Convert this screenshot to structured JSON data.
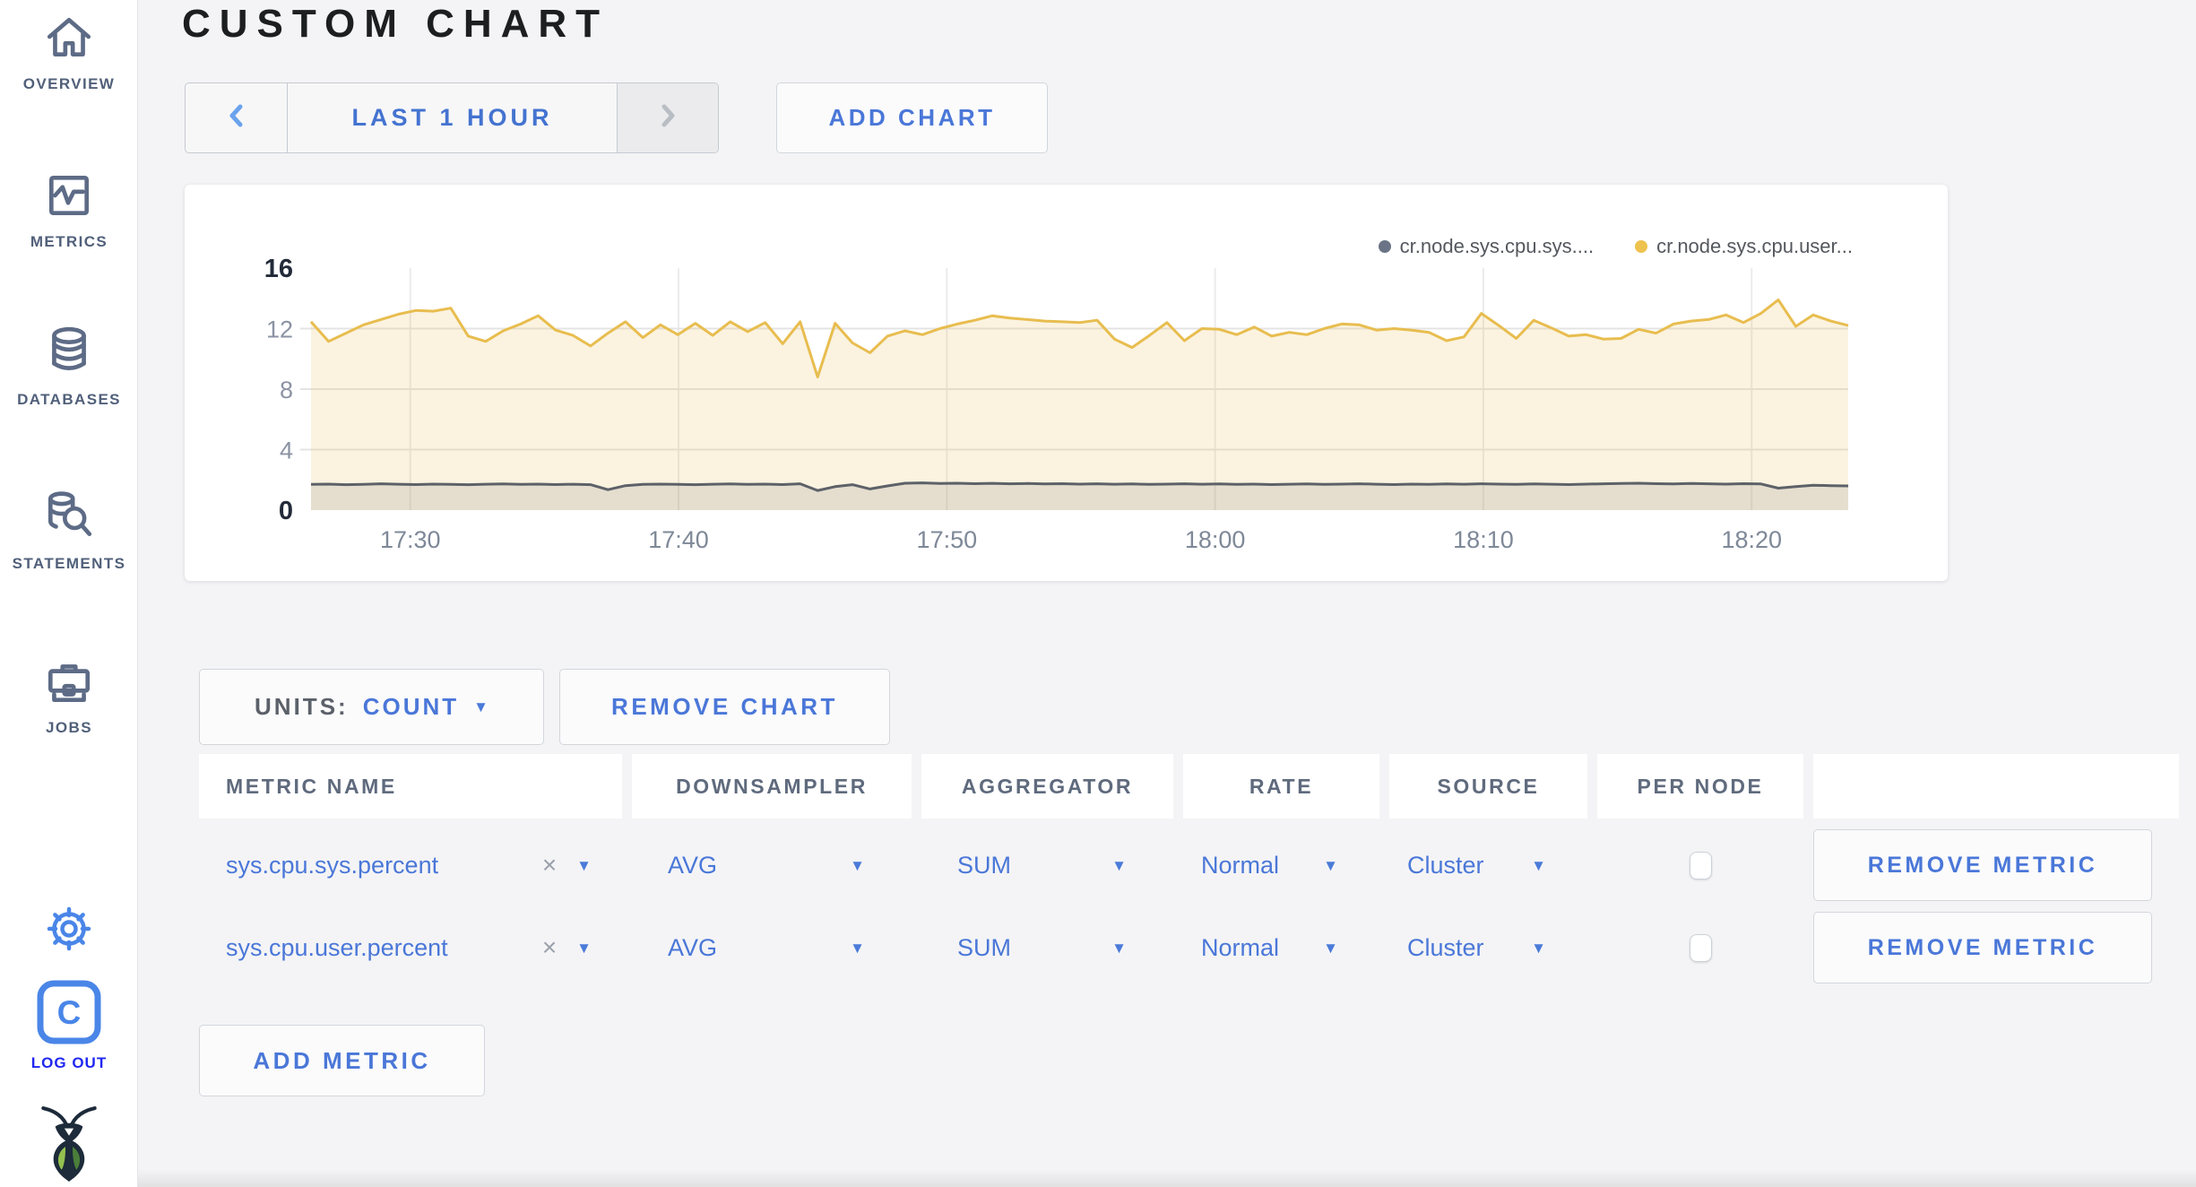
{
  "sidebar": {
    "items": [
      {
        "label": "OVERVIEW",
        "icon": "home-icon"
      },
      {
        "label": "METRICS",
        "icon": "metrics-icon"
      },
      {
        "label": "DATABASES",
        "icon": "database-icon"
      },
      {
        "label": "STATEMENTS",
        "icon": "statements-icon"
      },
      {
        "label": "JOBS",
        "icon": "jobs-icon"
      }
    ],
    "logout_label": "LOG OUT"
  },
  "header": {
    "title": "CUSTOM CHART"
  },
  "toolbar": {
    "time_range_label": "LAST 1 HOUR",
    "add_chart_label": "ADD CHART"
  },
  "chart_controls": {
    "units_label": "UNITS:",
    "units_value": "COUNT",
    "remove_chart_label": "REMOVE CHART",
    "add_metric_label": "ADD METRIC"
  },
  "table": {
    "headers": [
      "METRIC NAME",
      "DOWNSAMPLER",
      "AGGREGATOR",
      "RATE",
      "SOURCE",
      "PER NODE",
      ""
    ],
    "rows": [
      {
        "metric": "sys.cpu.sys.percent",
        "downsampler": "AVG",
        "aggregator": "SUM",
        "rate": "Normal",
        "source": "Cluster",
        "per_node_checked": false,
        "remove_label": "REMOVE METRIC"
      },
      {
        "metric": "sys.cpu.user.percent",
        "downsampler": "AVG",
        "aggregator": "SUM",
        "rate": "Normal",
        "source": "Cluster",
        "per_node_checked": false,
        "remove_label": "REMOVE METRIC"
      }
    ]
  },
  "colors": {
    "accent_blue": "#4a77d8",
    "chevron_enabled": "#6aa2ec",
    "chevron_disabled": "#b9bdc4",
    "logout_blue": "#1f27f0"
  },
  "chart_data": {
    "type": "line",
    "title": "",
    "xlabel": "",
    "ylabel": "",
    "grid": true,
    "legend_position": "top-right",
    "ylim": [
      0,
      16
    ],
    "y_ticks": [
      0,
      4,
      8,
      12,
      16
    ],
    "x_domain_min": [
      1046.3,
      1103.6
    ],
    "x_ticks": [
      {
        "label": "17:30",
        "min": 1050
      },
      {
        "label": "17:40",
        "min": 1060
      },
      {
        "label": "17:50",
        "min": 1070
      },
      {
        "label": "18:00",
        "min": 1080
      },
      {
        "label": "18:10",
        "min": 1090
      },
      {
        "label": "18:20",
        "min": 1100
      }
    ],
    "series": [
      {
        "name": "cr.node.sys.cpu.sys....",
        "color": "#5d6168",
        "fill": "rgba(96,99,106,0.14)",
        "dot_color": "#6b7486",
        "values": [
          1.7,
          1.72,
          1.68,
          1.7,
          1.74,
          1.71,
          1.69,
          1.72,
          1.7,
          1.68,
          1.71,
          1.73,
          1.7,
          1.72,
          1.69,
          1.71,
          1.68,
          1.35,
          1.62,
          1.7,
          1.72,
          1.7,
          1.68,
          1.71,
          1.73,
          1.7,
          1.72,
          1.69,
          1.74,
          1.3,
          1.55,
          1.68,
          1.4,
          1.6,
          1.78,
          1.8,
          1.76,
          1.78,
          1.75,
          1.77,
          1.74,
          1.76,
          1.73,
          1.75,
          1.72,
          1.74,
          1.71,
          1.73,
          1.7,
          1.72,
          1.74,
          1.71,
          1.73,
          1.7,
          1.72,
          1.69,
          1.71,
          1.73,
          1.7,
          1.72,
          1.74,
          1.71,
          1.69,
          1.72,
          1.7,
          1.73,
          1.71,
          1.74,
          1.72,
          1.7,
          1.73,
          1.71,
          1.69,
          1.72,
          1.74,
          1.76,
          1.78,
          1.75,
          1.73,
          1.76,
          1.74,
          1.72,
          1.75,
          1.73,
          1.45,
          1.55,
          1.65,
          1.62,
          1.6
        ]
      },
      {
        "name": "cr.node.sys.cpu.user...",
        "color": "#e8bd4f",
        "fill": "rgba(231,186,82,0.18)",
        "dot_color": "#eec24e",
        "values": [
          12.45,
          11.15,
          11.7,
          12.25,
          12.6,
          12.95,
          13.2,
          13.15,
          13.35,
          11.5,
          11.15,
          11.85,
          12.3,
          12.85,
          11.9,
          11.55,
          10.85,
          11.7,
          12.45,
          11.4,
          12.25,
          11.6,
          12.35,
          11.55,
          12.45,
          11.8,
          12.4,
          11.0,
          12.45,
          8.8,
          12.35,
          11.05,
          10.4,
          11.5,
          11.85,
          11.6,
          12.0,
          12.3,
          12.55,
          12.85,
          12.7,
          12.6,
          12.5,
          12.45,
          12.4,
          12.55,
          11.3,
          10.75,
          11.55,
          12.4,
          11.2,
          12.0,
          11.95,
          11.6,
          12.1,
          11.5,
          11.75,
          11.6,
          12.0,
          12.3,
          12.25,
          11.9,
          12.0,
          11.9,
          11.75,
          11.2,
          11.45,
          13.0,
          12.2,
          11.35,
          12.55,
          12.05,
          11.5,
          11.6,
          11.3,
          11.35,
          11.95,
          11.7,
          12.3,
          12.5,
          12.6,
          12.9,
          12.4,
          13.0,
          13.9,
          12.15,
          12.9,
          12.5,
          12.2
        ]
      }
    ]
  }
}
